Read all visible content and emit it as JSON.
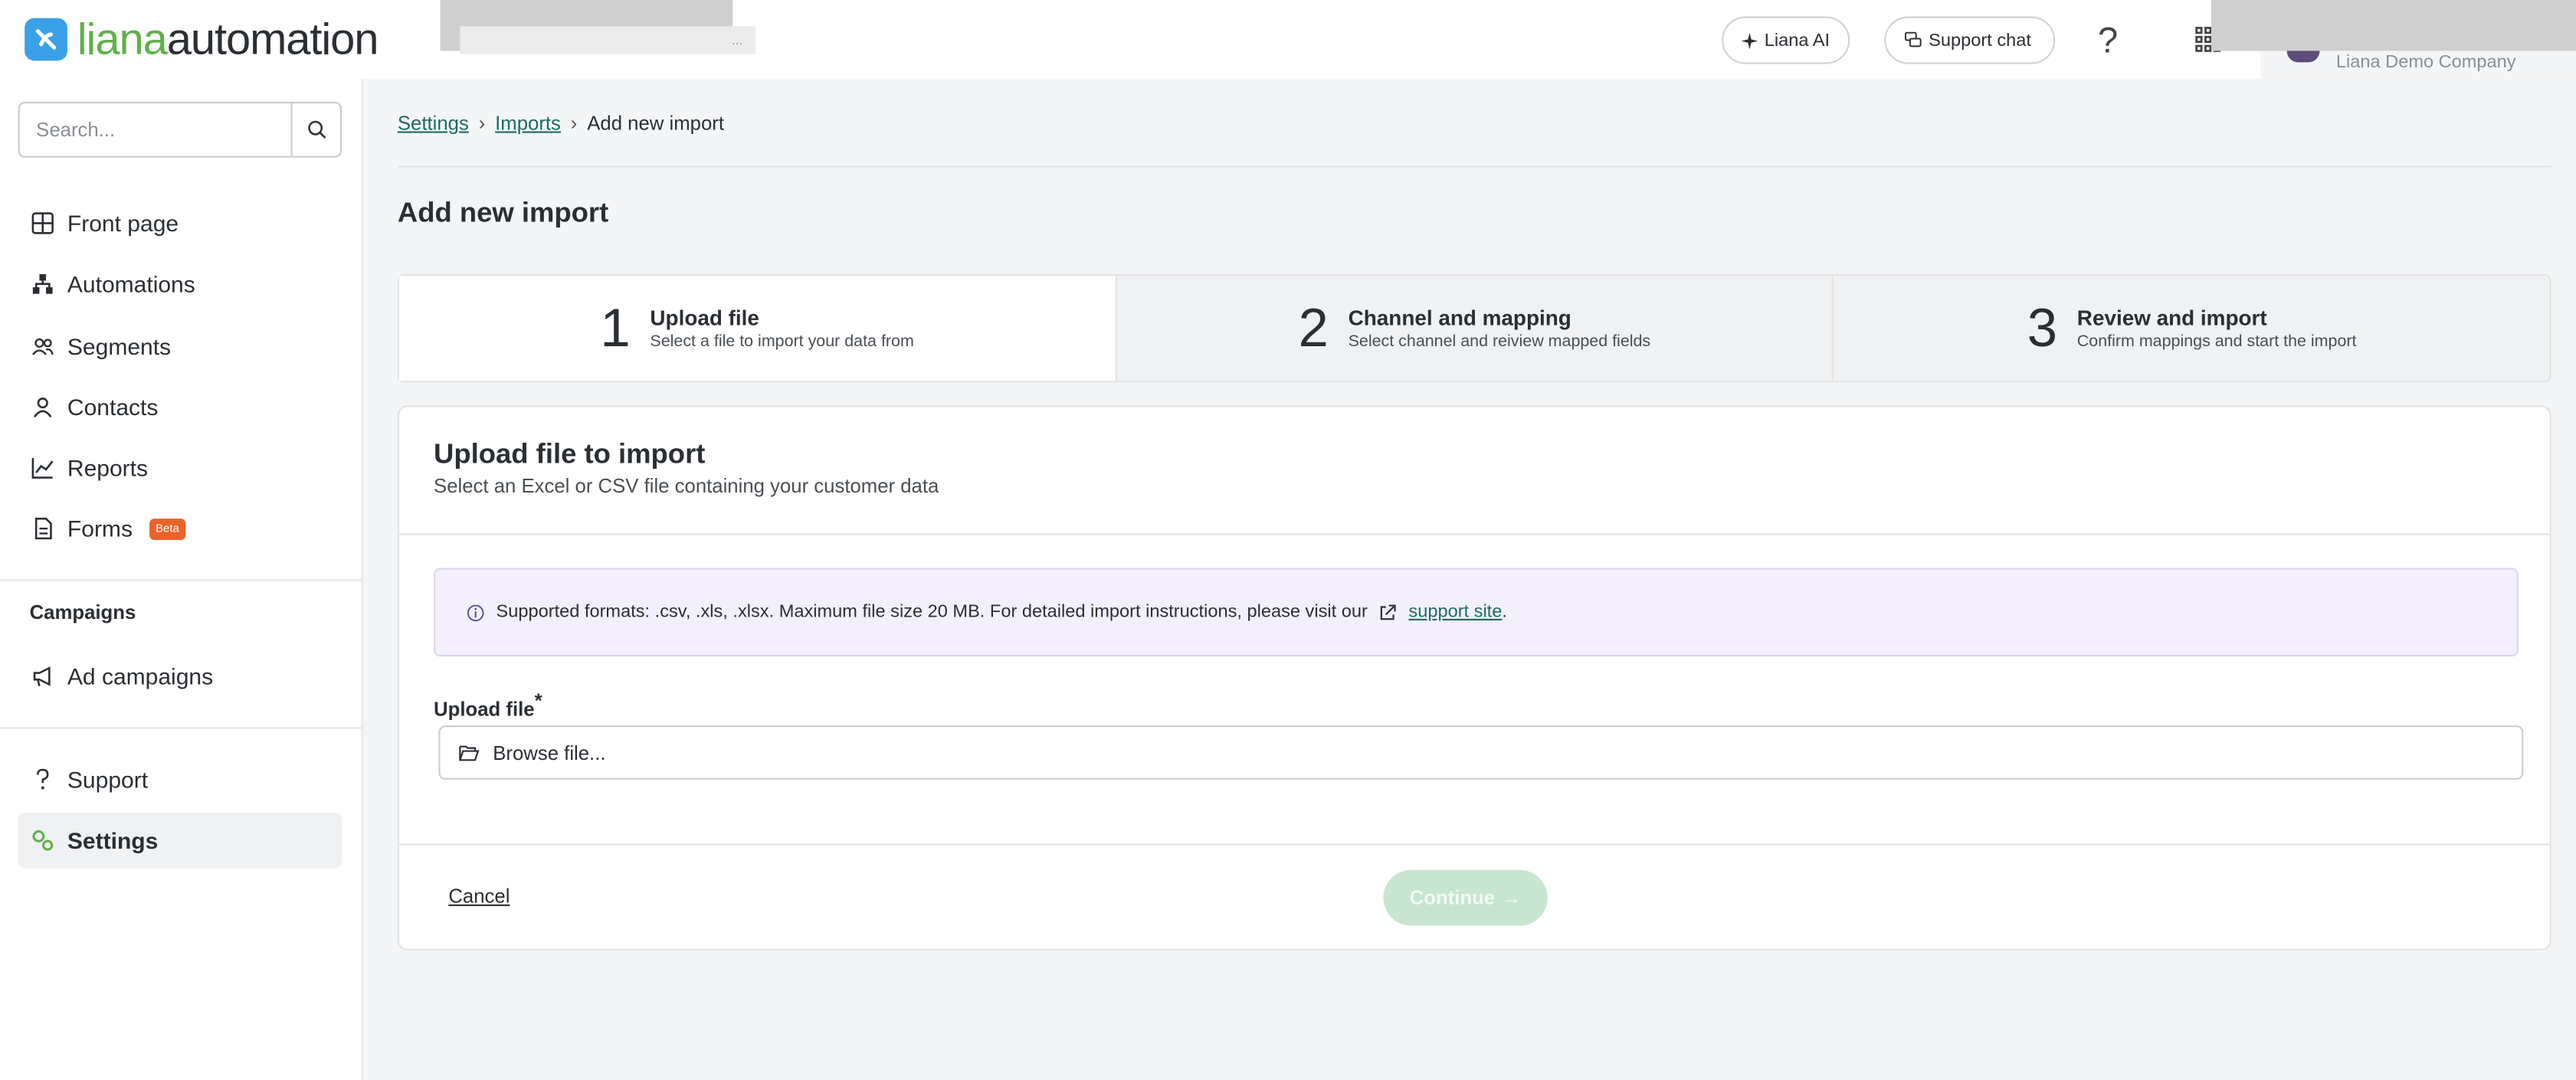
{
  "header": {
    "logo_a": "liana",
    "logo_b": "automation",
    "redacted_hint": "...",
    "ai_label": "Liana AI",
    "chat_label": "Support chat",
    "company": "Liana Demo Company"
  },
  "sidebar": {
    "search_placeholder": "Search...",
    "items": [
      {
        "label": "Front page",
        "icon": "grid-icon"
      },
      {
        "label": "Automations",
        "icon": "hierarchy-icon"
      },
      {
        "label": "Segments",
        "icon": "users-icon"
      },
      {
        "label": "Contacts",
        "icon": "user-icon"
      },
      {
        "label": "Reports",
        "icon": "chart-icon"
      },
      {
        "label": "Forms",
        "icon": "document-icon",
        "badge": "Beta"
      }
    ],
    "campaigns_title": "Campaigns",
    "campaign_items": [
      {
        "label": "Ad campaigns",
        "icon": "megaphone-icon"
      }
    ],
    "bottom_items": [
      {
        "label": "Support",
        "icon": "question-icon"
      },
      {
        "label": "Settings",
        "icon": "gears-icon"
      }
    ]
  },
  "breadcrumb": {
    "settings": "Settings",
    "imports": "Imports",
    "current": "Add new import"
  },
  "page_title": "Add new import",
  "steps": [
    {
      "num": "1",
      "title": "Upload file",
      "sub": "Select a file to import your data from"
    },
    {
      "num": "2",
      "title": "Channel and mapping",
      "sub": "Select channel and reiview mapped fields"
    },
    {
      "num": "3",
      "title": "Review and import",
      "sub": "Confirm mappings and start the import"
    }
  ],
  "card": {
    "title": "Upload file to import",
    "subtitle": "Select an Excel or CSV file containing your customer data",
    "info_text": "Supported formats: .csv, .xls, .xlsx. Maximum file size 20 MB. For detailed import instructions, please visit our",
    "info_link": "support site",
    "info_end": ".",
    "upload_label": "Upload file",
    "required_mark": "*",
    "browse_placeholder": "Browse file...",
    "cancel": "Cancel",
    "continue": "Continue"
  },
  "colors": {
    "brand_green": "#5fb04b",
    "logo_blue": "#3aa0e8",
    "link_green": "#1f6b63",
    "info_bg": "#f3efff",
    "continue_disabled": "#c8e6cf",
    "beta_orange": "#e8632b"
  }
}
